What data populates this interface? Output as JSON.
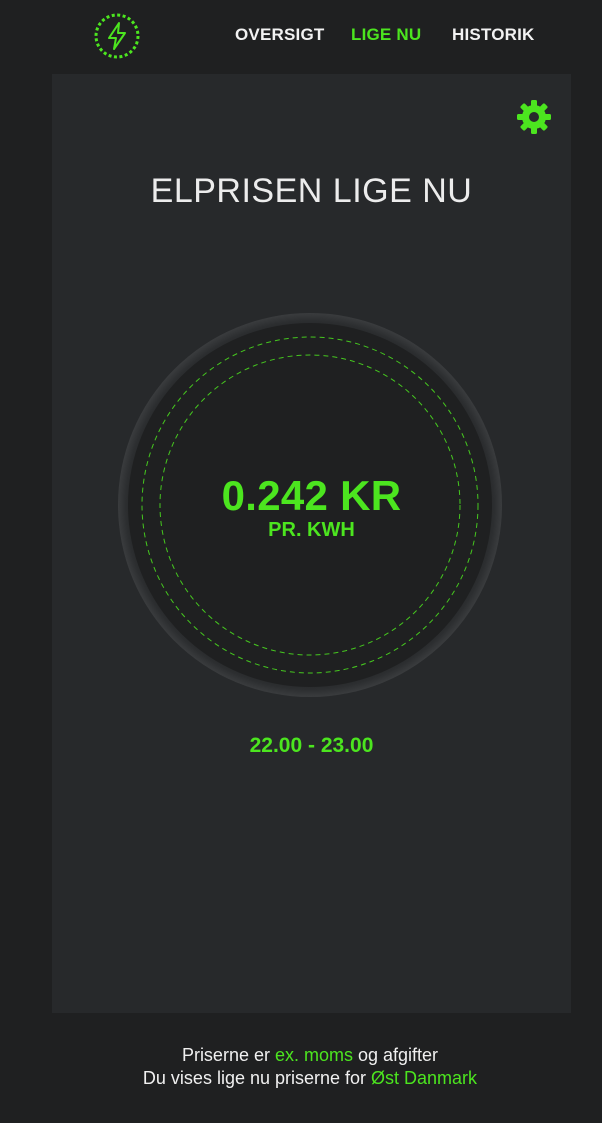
{
  "nav": {
    "logo_icon": "lightning-bolt-icon",
    "items": [
      {
        "label": "OVERSIGT",
        "active": false
      },
      {
        "label": "LIGE NU",
        "active": true
      },
      {
        "label": "HISTORIK",
        "active": false
      }
    ]
  },
  "main": {
    "settings_icon": "gear-icon",
    "title": "ELPRISEN LIGE NU",
    "price": "0.242 KR",
    "unit": "PR. KWH",
    "time_range": "22.00 - 23.00"
  },
  "footer": {
    "line1_prefix": "Priserne er ",
    "line1_highlight": "ex. moms",
    "line1_suffix": " og afgifter",
    "line2_prefix": "Du vises lige nu priserne for ",
    "line2_highlight": "Øst Danmark"
  },
  "colors": {
    "accent": "#4ce51f",
    "background": "#1f2021",
    "panel": "#27292b",
    "text": "#f2f2f2"
  }
}
